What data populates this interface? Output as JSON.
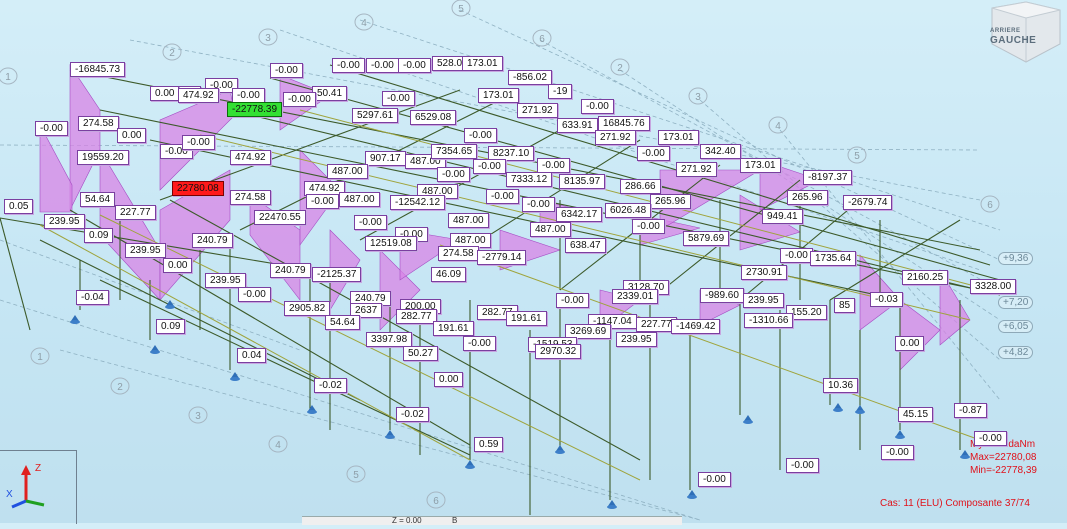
{
  "view_cube": {
    "label": "GAUCHE",
    "side": "ARRIERE"
  },
  "legend": {
    "line1": "My 2000daNm",
    "line2": "Max=22780,08",
    "line3": "Min=-22778,39"
  },
  "case_text": "Cas: 11 (ELU) Composante 37/74",
  "axis": {
    "z": "Z",
    "x": "X"
  },
  "status": {
    "a": "Z = 0.00",
    "b": "B"
  },
  "levels": [
    "+9,36",
    "+7,20",
    "+6,05",
    "+4,82"
  ],
  "grid_numbers": [
    "1",
    "2",
    "3",
    "4",
    "5",
    "6",
    "2",
    "3",
    "4",
    "5",
    "6",
    "1",
    "2",
    "3",
    "4",
    "5",
    "6"
  ],
  "labels": [
    {
      "t": "-16845.73",
      "k": ""
    },
    {
      "t": "-0.00",
      "k": ""
    },
    {
      "t": "-0.00",
      "k": ""
    },
    {
      "t": "-0.00",
      "k": ""
    },
    {
      "t": "-0.00",
      "k": ""
    },
    {
      "t": "-0.00",
      "k": ""
    },
    {
      "t": "528.03",
      "k": ""
    },
    {
      "t": "173.01",
      "k": ""
    },
    {
      "t": "-856.02",
      "k": ""
    },
    {
      "t": "-19",
      "k": ""
    },
    {
      "t": "0.00",
      "k": ""
    },
    {
      "t": "-0.00",
      "k": ""
    },
    {
      "t": "474.92",
      "k": ""
    },
    {
      "t": "-0.00",
      "k": ""
    },
    {
      "t": "50.41",
      "k": ""
    },
    {
      "t": "-0.00",
      "k": ""
    },
    {
      "t": "-0.00",
      "k": ""
    },
    {
      "t": "173.01",
      "k": ""
    },
    {
      "t": "-22778.39",
      "k": "min"
    },
    {
      "t": "5297.61",
      "k": ""
    },
    {
      "t": "6529.08",
      "k": ""
    },
    {
      "t": "271.92",
      "k": ""
    },
    {
      "t": "-0.00",
      "k": ""
    },
    {
      "t": "633.91",
      "k": ""
    },
    {
      "t": "16845.76",
      "k": ""
    },
    {
      "t": "-0.00",
      "k": ""
    },
    {
      "t": "274.58",
      "k": ""
    },
    {
      "t": "0.00",
      "k": ""
    },
    {
      "t": "-0.00",
      "k": ""
    },
    {
      "t": "-0.00",
      "k": ""
    },
    {
      "t": "-0.00",
      "k": ""
    },
    {
      "t": "271.92",
      "k": ""
    },
    {
      "t": "173.01",
      "k": ""
    },
    {
      "t": "19559.20",
      "k": ""
    },
    {
      "t": "474.92",
      "k": ""
    },
    {
      "t": "907.17",
      "k": ""
    },
    {
      "t": "487.00",
      "k": ""
    },
    {
      "t": "7354.65",
      "k": ""
    },
    {
      "t": "8237.10",
      "k": ""
    },
    {
      "t": "-0.00",
      "k": ""
    },
    {
      "t": "342.40",
      "k": ""
    },
    {
      "t": "487.00",
      "k": ""
    },
    {
      "t": "-0.00",
      "k": ""
    },
    {
      "t": "-0.00",
      "k": ""
    },
    {
      "t": "271.92",
      "k": ""
    },
    {
      "t": "173.01",
      "k": ""
    },
    {
      "t": "-8197.37",
      "k": ""
    },
    {
      "t": "22780.08",
      "k": "max"
    },
    {
      "t": "474.92",
      "k": ""
    },
    {
      "t": "487.00",
      "k": ""
    },
    {
      "t": "-0.00",
      "k": ""
    },
    {
      "t": "7333.12",
      "k": ""
    },
    {
      "t": "8135.97",
      "k": ""
    },
    {
      "t": "286.66",
      "k": ""
    },
    {
      "t": "54.64",
      "k": ""
    },
    {
      "t": "274.58",
      "k": ""
    },
    {
      "t": "-0.00",
      "k": ""
    },
    {
      "t": "487.00",
      "k": ""
    },
    {
      "t": "-12542.12",
      "k": ""
    },
    {
      "t": "-0.00",
      "k": ""
    },
    {
      "t": "-0.00",
      "k": ""
    },
    {
      "t": "265.96",
      "k": ""
    },
    {
      "t": "265.96",
      "k": ""
    },
    {
      "t": "-2679.74",
      "k": ""
    },
    {
      "t": "0.05",
      "k": ""
    },
    {
      "t": "227.77",
      "k": ""
    },
    {
      "t": "22470.55",
      "k": ""
    },
    {
      "t": "-0.00",
      "k": ""
    },
    {
      "t": "487.00",
      "k": ""
    },
    {
      "t": "6342.17",
      "k": ""
    },
    {
      "t": "6026.48",
      "k": ""
    },
    {
      "t": "949.41",
      "k": ""
    },
    {
      "t": "239.95",
      "k": ""
    },
    {
      "t": "-0.00",
      "k": ""
    },
    {
      "t": "487.00",
      "k": ""
    },
    {
      "t": "-0.00",
      "k": ""
    },
    {
      "t": "0.09",
      "k": ""
    },
    {
      "t": "12519.08",
      "k": ""
    },
    {
      "t": "487.00",
      "k": ""
    },
    {
      "t": "5879.69",
      "k": ""
    },
    {
      "t": "240.79",
      "k": ""
    },
    {
      "t": "638.47",
      "k": ""
    },
    {
      "t": "239.95",
      "k": ""
    },
    {
      "t": "274.58",
      "k": ""
    },
    {
      "t": "-2779.14",
      "k": ""
    },
    {
      "t": "-0.00",
      "k": ""
    },
    {
      "t": "1735.64",
      "k": ""
    },
    {
      "t": "0.00",
      "k": ""
    },
    {
      "t": "240.79",
      "k": ""
    },
    {
      "t": "-2125.37",
      "k": ""
    },
    {
      "t": "46.09",
      "k": ""
    },
    {
      "t": "2730.91",
      "k": ""
    },
    {
      "t": "239.95",
      "k": ""
    },
    {
      "t": "3128.70",
      "k": ""
    },
    {
      "t": "2160.25",
      "k": ""
    },
    {
      "t": "-0.04",
      "k": ""
    },
    {
      "t": "-0.00",
      "k": ""
    },
    {
      "t": "240.79",
      "k": ""
    },
    {
      "t": "3328.00",
      "k": ""
    },
    {
      "t": "2905.82",
      "k": ""
    },
    {
      "t": "200.00",
      "k": ""
    },
    {
      "t": "-0.00",
      "k": ""
    },
    {
      "t": "2339.01",
      "k": ""
    },
    {
      "t": "-989.60",
      "k": ""
    },
    {
      "t": "239.95",
      "k": ""
    },
    {
      "t": "2637",
      "k": ""
    },
    {
      "t": "282.77",
      "k": ""
    },
    {
      "t": "191.61",
      "k": ""
    },
    {
      "t": "85",
      "k": ""
    },
    {
      "t": "-0.03",
      "k": ""
    },
    {
      "t": "0.09",
      "k": ""
    },
    {
      "t": "54.64",
      "k": ""
    },
    {
      "t": "282.77",
      "k": ""
    },
    {
      "t": "-1147.04",
      "k": ""
    },
    {
      "t": "155.20",
      "k": ""
    },
    {
      "t": "3269.69",
      "k": ""
    },
    {
      "t": "227.77",
      "k": ""
    },
    {
      "t": "191.61",
      "k": ""
    },
    {
      "t": "-1310.66",
      "k": ""
    },
    {
      "t": "-1469.42",
      "k": ""
    },
    {
      "t": "239.95",
      "k": ""
    },
    {
      "t": "3397.98",
      "k": ""
    },
    {
      "t": "-0.00",
      "k": ""
    },
    {
      "t": "-1519.53",
      "k": ""
    },
    {
      "t": "2970.32",
      "k": ""
    },
    {
      "t": "0.00",
      "k": ""
    },
    {
      "t": "0.04",
      "k": ""
    },
    {
      "t": "50.27",
      "k": ""
    },
    {
      "t": "0.00",
      "k": ""
    },
    {
      "t": "-0.02",
      "k": ""
    },
    {
      "t": "-0.02",
      "k": ""
    },
    {
      "t": "10.36",
      "k": ""
    },
    {
      "t": "45.15",
      "k": ""
    },
    {
      "t": "-0.87",
      "k": ""
    },
    {
      "t": "-0.00",
      "k": ""
    },
    {
      "t": "0.59",
      "k": ""
    },
    {
      "t": "-0.00",
      "k": ""
    },
    {
      "t": "-0.00",
      "k": ""
    },
    {
      "t": "-0.00",
      "k": ""
    }
  ]
}
